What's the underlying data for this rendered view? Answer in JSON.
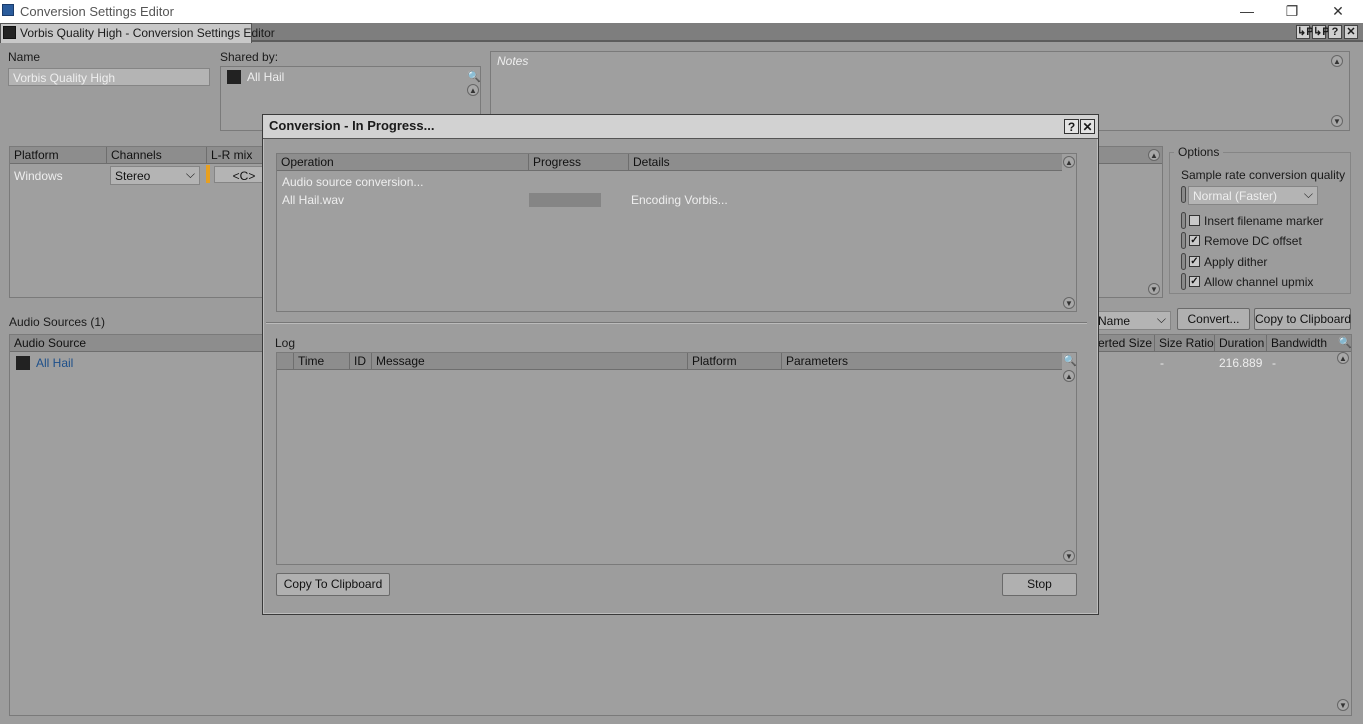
{
  "window": {
    "title": "Conversion Settings Editor",
    "minimize": "—",
    "restore": "❐",
    "close": "✕"
  },
  "tab": {
    "label": "Vorbis Quality High - Conversion Settings Editor",
    "buttons": [
      "↳P",
      "↳P",
      "?",
      "✕"
    ]
  },
  "name": {
    "label": "Name",
    "value": "Vorbis Quality High"
  },
  "shared": {
    "label": "Shared by:",
    "items": [
      "All Hail"
    ]
  },
  "notes": {
    "placeholder": "Notes"
  },
  "platform_table": {
    "headers": [
      "Platform",
      "Channels",
      "L-R mix"
    ],
    "row": {
      "platform": "Windows",
      "channels": "Stereo",
      "lr_mix": "<C>"
    }
  },
  "options": {
    "title": "Options",
    "quality_label": "Sample rate conversion quality",
    "quality_value": "Normal (Faster)",
    "checkboxes": [
      {
        "label": "Insert filename marker",
        "checked": false
      },
      {
        "label": "Remove DC offset",
        "checked": true
      },
      {
        "label": "Apply dither",
        "checked": true
      },
      {
        "label": "Allow channel upmix",
        "checked": true
      }
    ]
  },
  "sources": {
    "title": "Audio Sources (1)",
    "sort_value": "Name",
    "convert_label": "Convert...",
    "copy_label": "Copy to Clipboard",
    "headers": [
      "Audio Source",
      "erted Size",
      "Size Ratio",
      "Duration",
      "Bandwidth"
    ],
    "rows": [
      {
        "name": "All Hail",
        "converted_size": "",
        "size_ratio": "-",
        "duration": "216.889",
        "bandwidth": "-"
      }
    ]
  },
  "dialog": {
    "title": "Conversion - In Progress...",
    "help": "?",
    "close": "✕",
    "op_headers": [
      "Operation",
      "Progress",
      "Details"
    ],
    "op_rows": [
      {
        "operation": "Audio source conversion...",
        "progress": null,
        "details": ""
      },
      {
        "operation": "All Hail.wav",
        "progress": 0.0,
        "details": "Encoding Vorbis..."
      }
    ],
    "log_label": "Log",
    "log_headers": [
      "Time",
      "ID",
      "Message",
      "Platform",
      "Parameters"
    ],
    "copy_label": "Copy To Clipboard",
    "stop_label": "Stop"
  }
}
